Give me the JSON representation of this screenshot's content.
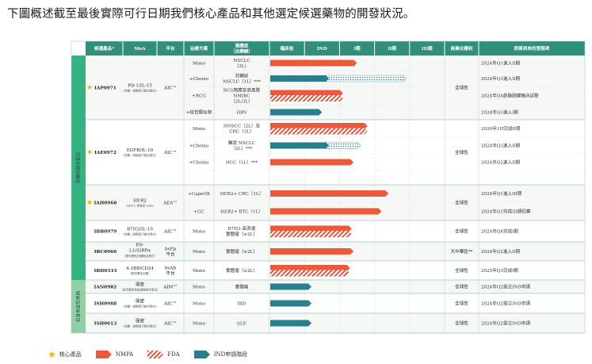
{
  "intro": "下圖概述截至最後實際可行日期我們核心產品和其他選定候選藥物的開發狀況。",
  "colors": {
    "header_bg": "#2f8f7b",
    "header_text": "#ffffff",
    "row_bg_a": "#f6f8f6",
    "row_bg_b": "#ffffff",
    "group_core": "#36b282",
    "group_auto": "#8fd0a4",
    "nmpa": "#ec5a3c",
    "fda": "#d95a47",
    "ind": "#2a7f8f",
    "star": "#f0b400"
  },
  "header": {
    "candidate": "候選產品*",
    "moa": "MoA",
    "platform": "平台",
    "therapy": "治療方案",
    "indication": "適應症\n（治療線）",
    "preclinical": "臨床前",
    "ind": "IND",
    "phase1": "I期",
    "phase2": "II期",
    "phase3": "III期",
    "commercial": "商業化權利",
    "milestone": "即將到來的里程碑"
  },
  "groups": [
    {
      "label": "抗體和融合蛋白",
      "color_key": "group_core",
      "from": 0,
      "to": 12
    },
    {
      "label": "自身免疫性疾病",
      "color_key": "group_auto",
      "from": 13,
      "to": 15
    }
  ],
  "products": [
    {
      "name": "IAP0971",
      "star": true,
      "moa": "PD-1/IL-15",
      "moa_sub": "（抗體－細胞因子融合蛋白）",
      "platform": "AIC™",
      "rights": "全球性",
      "from": 0,
      "to": 3
    },
    {
      "name": "IAE0972",
      "star": true,
      "moa": "EGFR/IL-10",
      "moa_sub": "（抗體－細胞因子融合蛋白）",
      "platform": "AIC™",
      "rights": "全球性",
      "from": 4,
      "to": 7
    },
    {
      "name": "IAH0968",
      "star": true,
      "moa": "HER2",
      "moa_sub": "（ADCC 增強型 mAb）",
      "platform": "AEA™",
      "rights": "全球性",
      "from": 8,
      "to": 9
    },
    {
      "name": "IBB0979",
      "star": false,
      "moa": "B7H3/IL-10",
      "moa_sub": "（抗體－細胞因子融合蛋白）",
      "platform": "AIC™",
      "rights": "全球性",
      "from": 10,
      "to": 10
    },
    {
      "name": "IBC0966",
      "star": false,
      "moa": "PD-\nL1/SIRPα",
      "moa_sub": "（雙特異性抗體融合蛋白）",
      "platform": "bsFp\n平台",
      "rights": "大中華區**",
      "from": 11,
      "to": 11
    },
    {
      "name": "IBD0333",
      "star": false,
      "moa": "4-1BB/CD24",
      "moa_sub": "（雙特異性抗體）",
      "platform": "bsAb\n平台",
      "rights": "全球性",
      "from": 12,
      "to": 12
    },
    {
      "name": "IAN0982",
      "star": false,
      "moa": "保密",
      "moa_sub": "（多特異性免疫細胞接合蛋白）",
      "platform": "AIM™",
      "rights": "全球性",
      "from": 13,
      "to": 13
    },
    {
      "name": "ISH0988",
      "star": false,
      "moa": "保密",
      "moa_sub": "（抗體－細胞因子融合蛋白）",
      "platform": "AIC™",
      "rights": "全球性",
      "from": 14,
      "to": 14
    },
    {
      "name": "ISH0613",
      "star": false,
      "moa": "保密",
      "moa_sub": "（抗體－細胞因子融合蛋白）",
      "platform": "AIC™",
      "rights": "全球性",
      "from": 15,
      "to": 15
    }
  ],
  "rows": [
    {
      "therapy": "Mono",
      "indication": "NSCLC\n（2L）",
      "bars": [
        {
          "type": "nmpa",
          "end": 2.5
        }
      ],
      "milestone": "2024年Q1進入II期"
    },
    {
      "therapy": "+Chemo",
      "indication": "非鱗狀\nNSCLC（1L）***",
      "bars": [
        {
          "type": "ind",
          "end": 1.7
        },
        {
          "type": "ind_dotted",
          "end": 3.9
        }
      ],
      "milestone": "2024年Q3進入II期"
    },
    {
      "therapy": "+BCG",
      "indication": "BCG無應答高風險\nNMIBC\n（2L/3L）",
      "bars": [
        {
          "type": "nmpa_fda",
          "end": 2.1
        }
      ],
      "milestone": "2024年Q4啟動關鍵臨床試驗"
    },
    {
      "therapy": "+核苷類似物",
      "indication": "HBV",
      "bars": [
        {
          "type": "ind",
          "end": 1.5
        }
      ],
      "milestone": "2024年Q3進入I期"
    },
    {
      "therapy": "Mono",
      "indication": "HNSCC（2L）及\nCRC（3L）",
      "bars": [
        {
          "type": "nmpa_fda",
          "end": 2.8
        }
      ],
      "milestone": "2026年1H完成II期"
    },
    {
      "therapy": "+Chemo",
      "indication": "鱗狀 NSCLC\n（2L）***",
      "bars": [
        {
          "type": "ind",
          "end": 1.7
        },
        {
          "type": "ind_dotted",
          "end": 2.6
        }
      ],
      "milestone": "2024年Q3進入II期"
    },
    {
      "therapy": "+Chemo",
      "indication": "HCC（1L）***",
      "bars": [
        {
          "type": "nmpa",
          "end": 2.4
        }
      ],
      "milestone": "2024年Q2進入II期"
    },
    {
      "therapy": "",
      "indication": "",
      "bars": [],
      "milestone": ""
    },
    {
      "therapy": "+CapeOX",
      "indication": "HER2+ CRC（1L）",
      "bars": [
        {
          "type": "nmpa",
          "end": 3.4
        }
      ],
      "milestone": "2024年Q1進入III期"
    },
    {
      "therapy": "+GC",
      "indication": "HER2+ BTC（1L）",
      "bars": [
        {
          "type": "nmpa",
          "end": 3.2
        }
      ],
      "milestone": "2024年Q1完成III期招募"
    },
    {
      "therapy": "Mono",
      "indication": "B7H3-高表達\n實體瘤（≥2L）",
      "bars": [
        {
          "type": "nmpa_fda",
          "end": 2.35
        }
      ],
      "milestone": "2024年Q4完成I期"
    },
    {
      "therapy": "Mono",
      "indication": "實體瘤（≥2L）",
      "bars": [
        {
          "type": "nmpa",
          "end": 2.4
        }
      ],
      "milestone": "2024年Q2進入II期"
    },
    {
      "therapy": "Mono",
      "indication": "實體瘤（≥2L）",
      "bars": [
        {
          "type": "nmpa_fda",
          "end": 2.3
        }
      ],
      "milestone": "2025年Q3完成I期"
    },
    {
      "therapy": "Mono",
      "indication": "實體瘤",
      "bars": [
        {
          "type": "ind",
          "end": 1.2
        }
      ],
      "milestone": "2024年Q2提交IND申請"
    },
    {
      "therapy": "Mono",
      "indication": "IBD",
      "bars": [
        {
          "type": "ind",
          "end": 1.2
        }
      ],
      "milestone": "2024年Q2提交IND申請"
    },
    {
      "therapy": "Mono",
      "indication": "SLE",
      "bars": [
        {
          "type": "ind",
          "end": 1.2
        }
      ],
      "milestone": "2024年Q2提交IND申請"
    }
  ],
  "legend": {
    "core": "核心產品",
    "nmpa": "NMPA",
    "fda": "FDA",
    "ind": "IND申請階段"
  }
}
